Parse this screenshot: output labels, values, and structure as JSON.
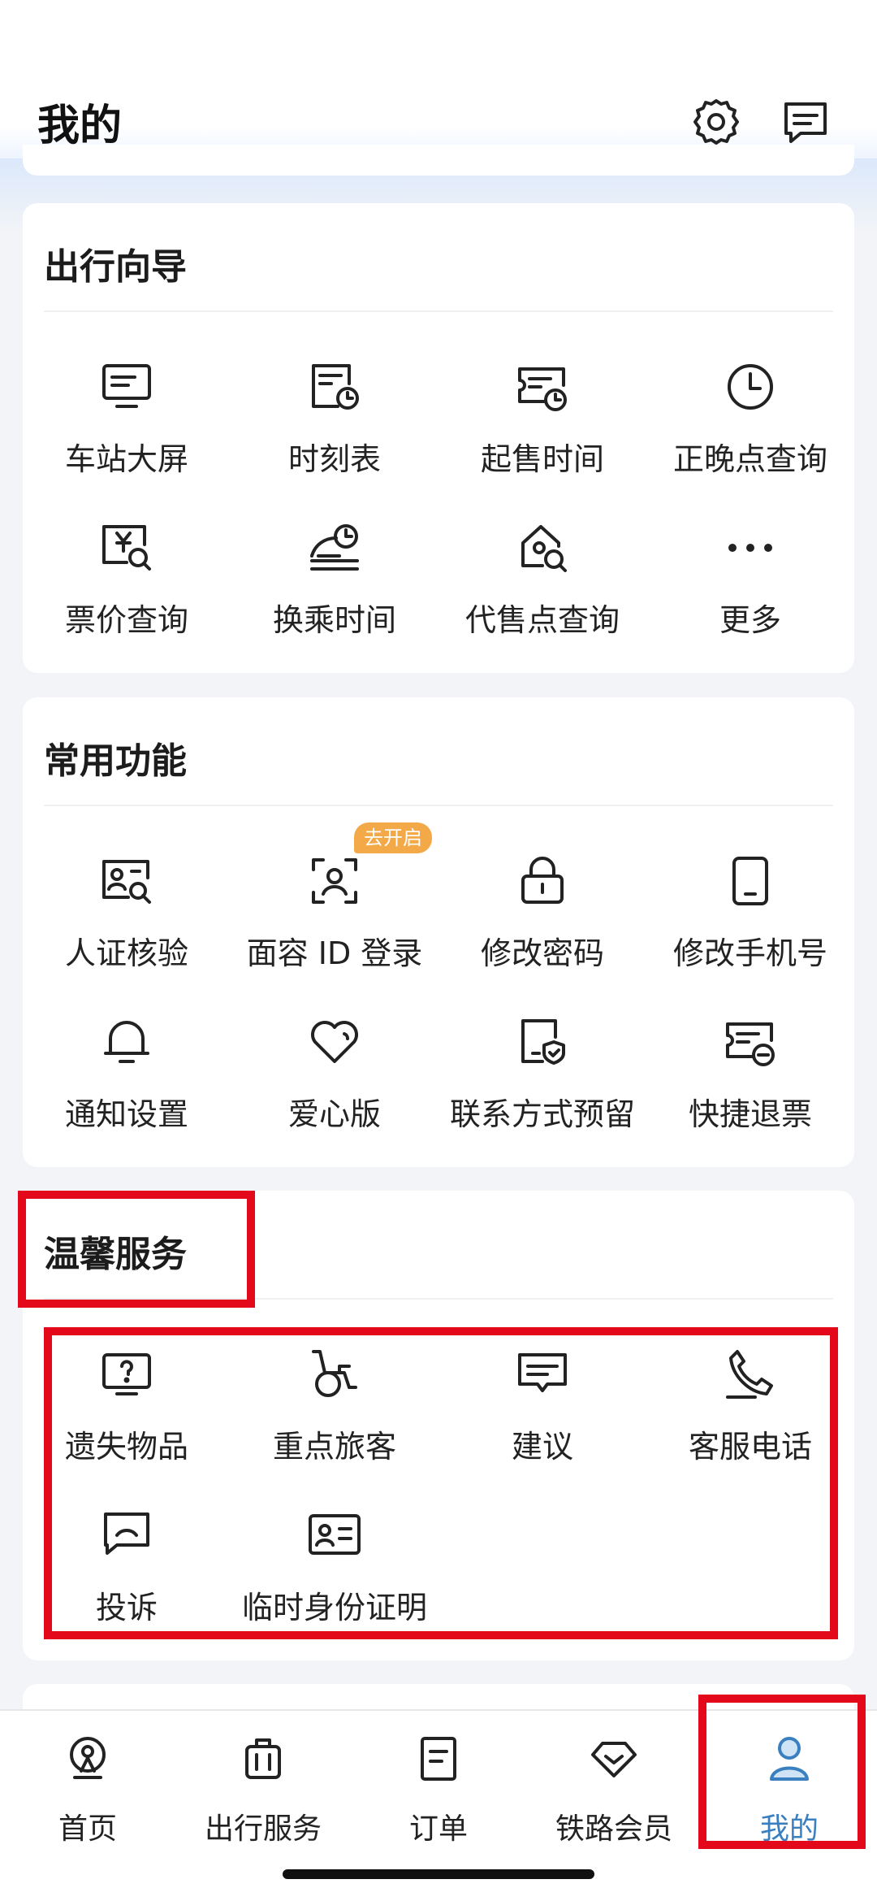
{
  "header": {
    "title": "我的"
  },
  "sections": {
    "travel_guide": {
      "title": "出行向导",
      "items": [
        {
          "label": "车站大屏",
          "icon": "monitor-icon"
        },
        {
          "label": "时刻表",
          "icon": "timetable-icon"
        },
        {
          "label": "起售时间",
          "icon": "ticket-clock-icon"
        },
        {
          "label": "正晚点查询",
          "icon": "clock-icon"
        },
        {
          "label": "票价查询",
          "icon": "price-search-icon"
        },
        {
          "label": "换乘时间",
          "icon": "transfer-time-icon"
        },
        {
          "label": "代售点查询",
          "icon": "house-search-icon"
        },
        {
          "label": "更多",
          "icon": "more-dots-icon"
        }
      ]
    },
    "common_functions": {
      "title": "常用功能",
      "badge": "去开启",
      "items": [
        {
          "label": "人证核验",
          "icon": "id-verify-icon"
        },
        {
          "label": "面容 ID 登录",
          "icon": "face-id-icon"
        },
        {
          "label": "修改密码",
          "icon": "lock-icon"
        },
        {
          "label": "修改手机号",
          "icon": "phone-icon"
        },
        {
          "label": "通知设置",
          "icon": "bell-icon"
        },
        {
          "label": "爱心版",
          "icon": "heart-icon"
        },
        {
          "label": "联系方式预留",
          "icon": "contact-shield-icon"
        },
        {
          "label": "快捷退票",
          "icon": "quick-refund-icon"
        }
      ]
    },
    "warm_service": {
      "title": "温馨服务",
      "items": [
        {
          "label": "遗失物品",
          "icon": "question-box-icon"
        },
        {
          "label": "重点旅客",
          "icon": "wheelchair-icon"
        },
        {
          "label": "建议",
          "icon": "suggestion-icon"
        },
        {
          "label": "客服电话",
          "icon": "phone-call-icon"
        },
        {
          "label": "投诉",
          "icon": "complaint-icon"
        },
        {
          "label": "临时身份证明",
          "icon": "id-card-icon"
        }
      ]
    }
  },
  "tabbar": {
    "items": [
      {
        "label": "首页",
        "icon": "home-train-icon"
      },
      {
        "label": "出行服务",
        "icon": "luggage-icon"
      },
      {
        "label": "订单",
        "icon": "order-icon"
      },
      {
        "label": "铁路会员",
        "icon": "diamond-icon"
      },
      {
        "label": "我的",
        "icon": "user-icon"
      }
    ],
    "active": "我的",
    "active_color": "#3a7fbf"
  },
  "colors": {
    "highlight_frame": "#e3091a",
    "badge": "#f3a947"
  }
}
